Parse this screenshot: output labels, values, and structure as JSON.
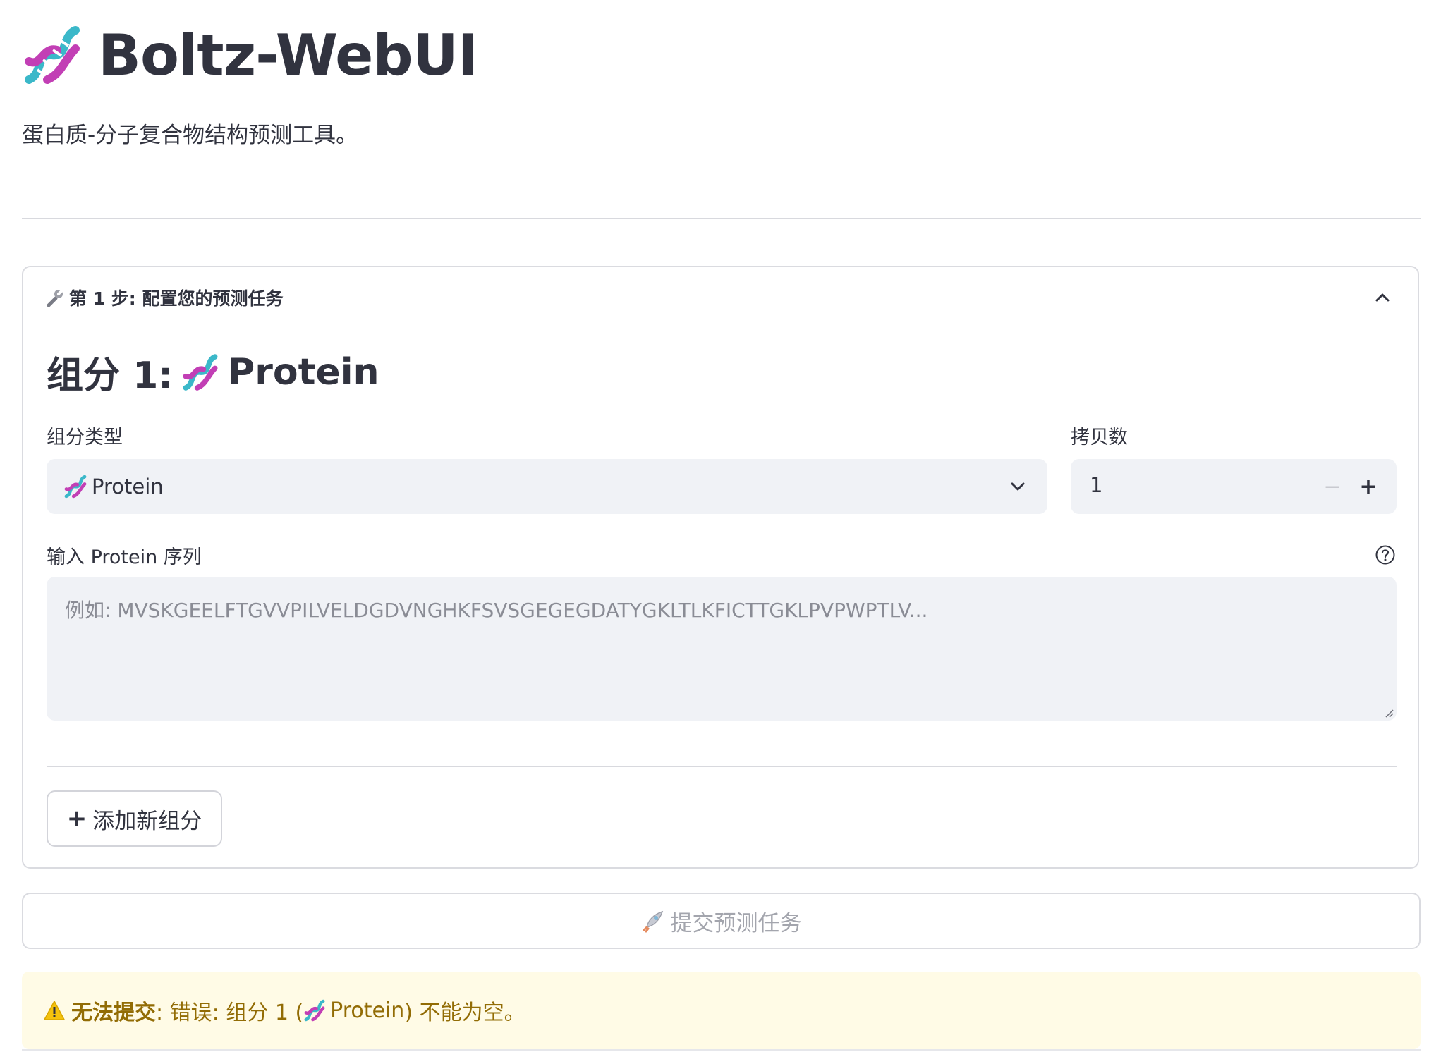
{
  "header": {
    "title": "Boltz-WebUI",
    "subtitle": "蛋白质-分子复合物结构预测工具。"
  },
  "expander": {
    "icon": "wrench-icon",
    "title": "第 1 步: 配置您的预测任务",
    "expanded": true
  },
  "component": {
    "heading_prefix": "组分 1:",
    "heading_name": "Protein",
    "type_label": "组分类型",
    "type_value": "Protein",
    "copies_label": "拷贝数",
    "copies_value": "1",
    "minus_label": "−",
    "plus_label": "+",
    "sequence_label": "输入 Protein 序列",
    "sequence_placeholder": "例如: MVSKGEELFTGVVPILVELDGDVNGHKFSVSGEGEGDATYGKLTLKFICTTGKLPVPWPTLV...",
    "sequence_value": ""
  },
  "actions": {
    "add_component_label": "添加新组分",
    "submit_label": "提交预测任务",
    "submit_disabled": true
  },
  "alert": {
    "strong": "无法提交",
    "message_prefix": ": 错误: 组分 1 (",
    "message_name": "Protein",
    "message_suffix": ") 不能为空。"
  },
  "colors": {
    "text": "#31333f",
    "input_bg": "#f0f2f6",
    "border": "#dadbe0",
    "alert_bg": "#fffbe6",
    "alert_text": "#926c05",
    "disabled_text": "#a3a5ad"
  }
}
